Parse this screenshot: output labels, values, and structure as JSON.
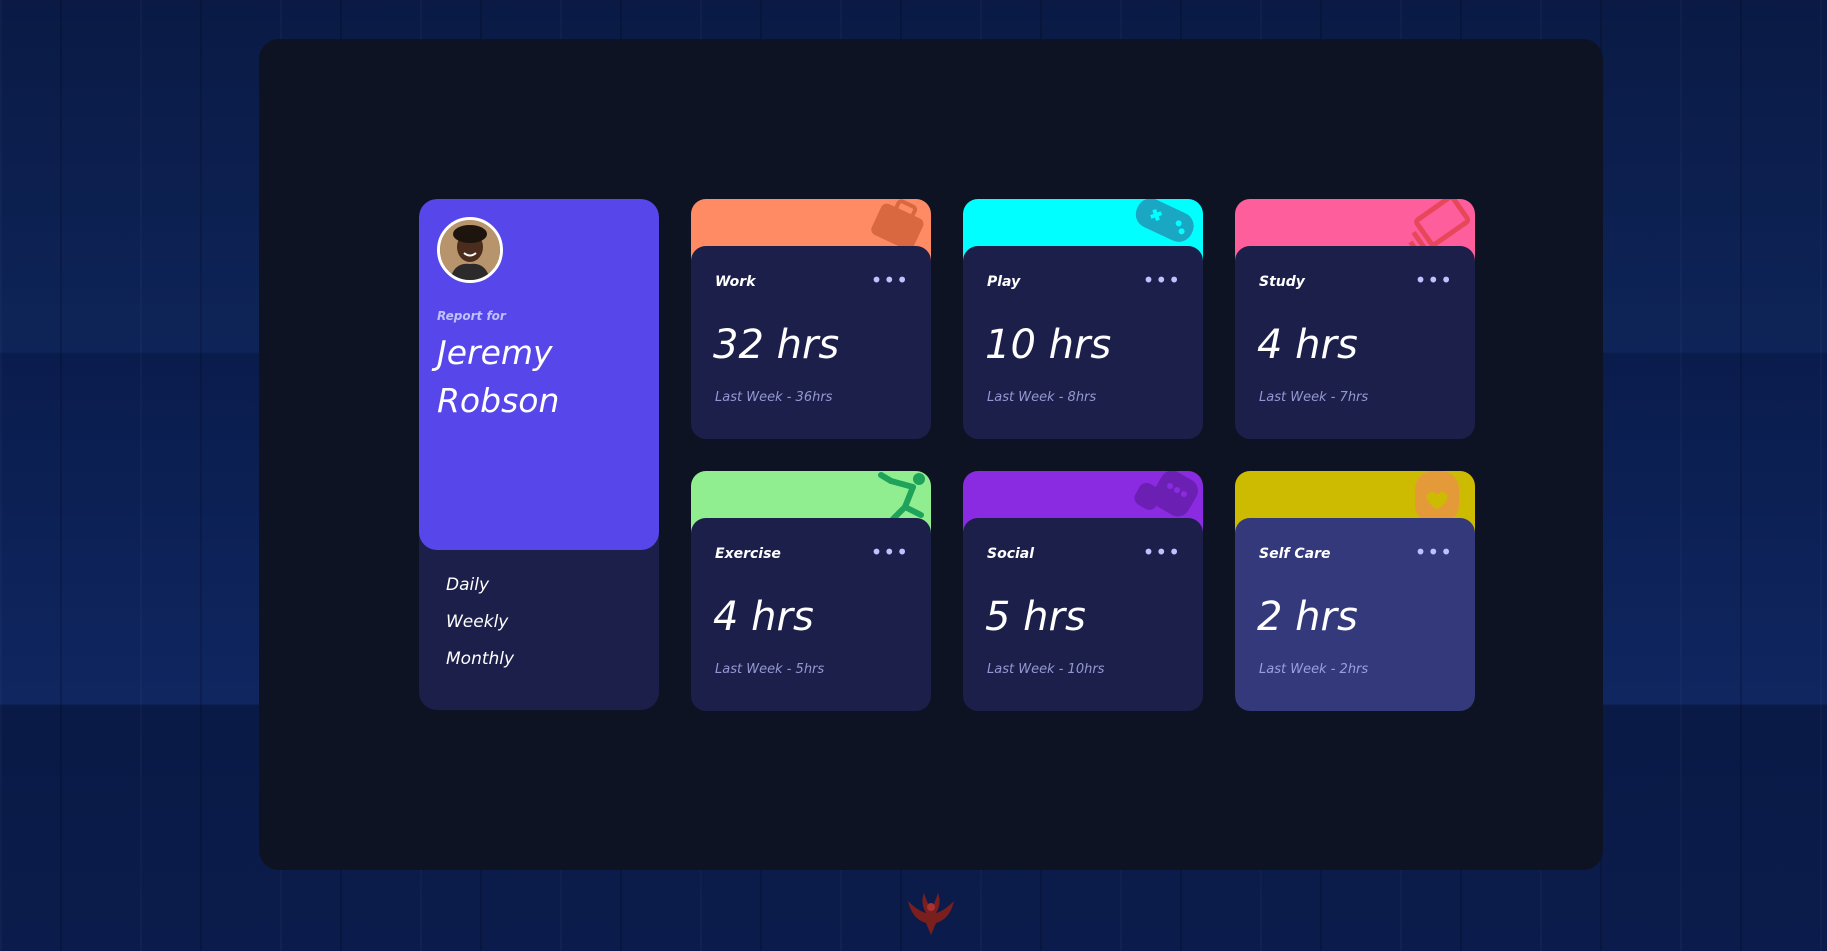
{
  "profile": {
    "report_label": "Report for",
    "name": "Jeremy Robson",
    "periods": [
      "Daily",
      "Weekly",
      "Monthly"
    ],
    "accent": "#5747ea"
  },
  "cards": [
    {
      "title": "Work",
      "hours": "32 hrs",
      "previous": "Last Week - 36hrs",
      "color": "#ff8b64",
      "icon": "briefcase-icon"
    },
    {
      "title": "Play",
      "hours": "10 hrs",
      "previous": "Last Week - 8hrs",
      "color": "#00ffff",
      "icon": "gamepad-icon"
    },
    {
      "title": "Study",
      "hours": "4 hrs",
      "previous": "Last Week - 7hrs",
      "color": "#ff5e7d",
      "icon": "book-icon"
    },
    {
      "title": "Exercise",
      "hours": "4 hrs",
      "previous": "Last Week - 5hrs",
      "color": "#90ee90",
      "icon": "runner-icon"
    },
    {
      "title": "Social",
      "hours": "5 hrs",
      "previous": "Last Week - 10hrs",
      "color": "#8a2be2",
      "icon": "social-icon"
    },
    {
      "title": "Self Care",
      "hours": "2 hrs",
      "previous": "Last Week - 2hrs",
      "color": "#ccbb00",
      "icon": "heart-icon"
    }
  ],
  "more_label": "•••"
}
